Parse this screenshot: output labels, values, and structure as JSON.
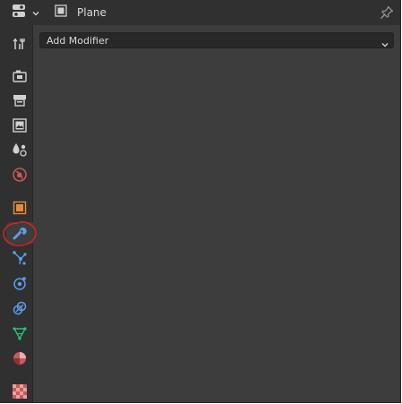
{
  "header": {
    "editor_type_icon": "properties-editor-icon",
    "object_icon": "object-data-icon",
    "object_name": "Plane",
    "pin_icon": "pin-icon"
  },
  "sidebar": {
    "tabs": [
      {
        "name": "tool",
        "icon": "tool-icon"
      },
      {
        "name": "render",
        "icon": "render-icon"
      },
      {
        "name": "output",
        "icon": "output-icon"
      },
      {
        "name": "view-layer",
        "icon": "view-layer-icon"
      },
      {
        "name": "scene",
        "icon": "scene-icon"
      },
      {
        "name": "world",
        "icon": "world-icon"
      },
      {
        "name": "object",
        "icon": "object-icon"
      },
      {
        "name": "modifiers",
        "icon": "wrench-icon",
        "active": true
      },
      {
        "name": "particles",
        "icon": "particles-icon"
      },
      {
        "name": "physics",
        "icon": "physics-icon"
      },
      {
        "name": "constraints",
        "icon": "constraints-icon"
      },
      {
        "name": "data",
        "icon": "mesh-data-icon"
      },
      {
        "name": "material",
        "icon": "material-icon"
      },
      {
        "name": "texture",
        "icon": "texture-icon"
      }
    ],
    "annotation": "red hand-drawn circle around modifiers tab"
  },
  "main": {
    "add_modifier_label": "Add Modifier"
  },
  "colors": {
    "panel_bg": "#3d3d3d",
    "header_bg": "#303030",
    "sidebar_bg": "#303030",
    "dropdown_bg": "#282828",
    "text": "#d9d9d9",
    "modifier_blue": "#5a9ee6",
    "object_orange": "#e88a3c",
    "world_red": "#c85a5a",
    "mesh_green": "#2fbf7a",
    "annotation_red": "#e02020"
  }
}
